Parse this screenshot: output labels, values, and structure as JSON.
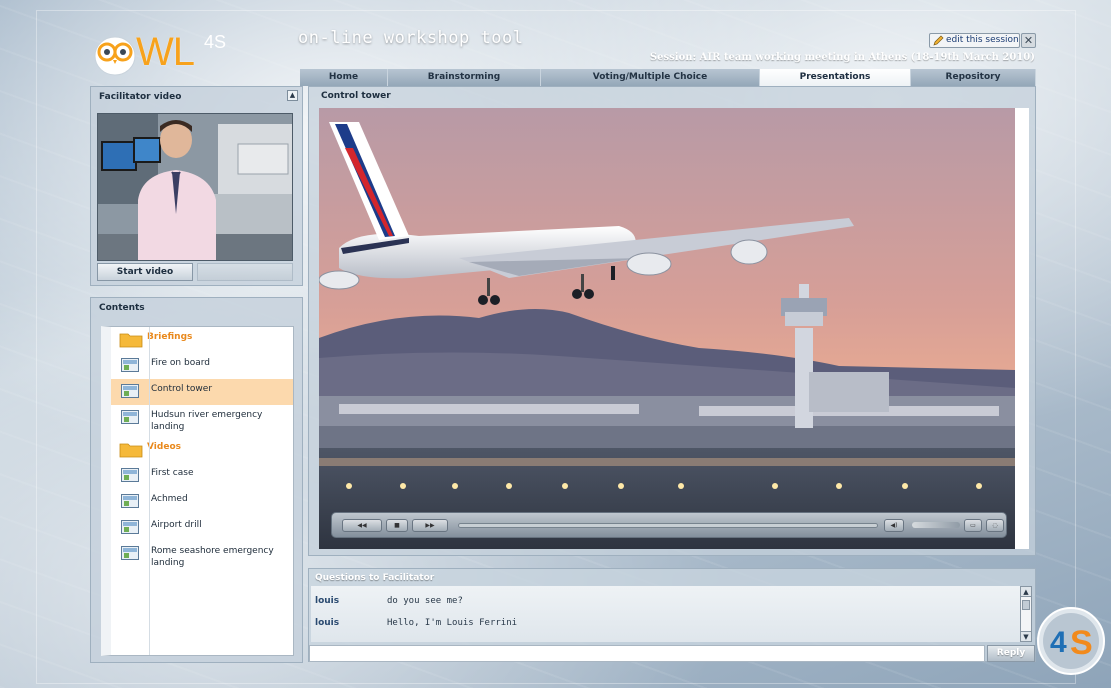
{
  "header": {
    "logo_text": "WL",
    "logo_sub": "4S",
    "app_title": "on-line workshop tool",
    "session_title": "Session: AIR team working meeting in Athens (18-19th March 2010)",
    "edit_label": "edit this session",
    "close_icon": "close-icon"
  },
  "tabs": [
    {
      "label": "Home",
      "active": false
    },
    {
      "label": "Brainstorming",
      "active": false
    },
    {
      "label": "Voting/Multiple Choice",
      "active": false
    },
    {
      "label": "Presentations",
      "active": true
    },
    {
      "label": "Repository",
      "active": false
    }
  ],
  "facilitator": {
    "title": "Facilitator video",
    "start_label": "Start video"
  },
  "contents": {
    "title": "Contents",
    "items": [
      {
        "type": "folder",
        "label": "Briefings"
      },
      {
        "type": "file",
        "label": "Fire on board"
      },
      {
        "type": "file",
        "label": "Control tower",
        "selected": true
      },
      {
        "type": "file",
        "label": "Hudsun river emergency landing"
      },
      {
        "type": "folder",
        "label": "Videos"
      },
      {
        "type": "file",
        "label": "First case"
      },
      {
        "type": "file",
        "label": "Achmed"
      },
      {
        "type": "file",
        "label": "Airport drill"
      },
      {
        "type": "file",
        "label": "Rome seashore emergency landing"
      }
    ]
  },
  "presentation": {
    "title": "Control tower"
  },
  "questions": {
    "title": "Questions to Facilitator",
    "messages": [
      {
        "user": "louis",
        "text": "do you see me?"
      },
      {
        "user": "louis",
        "text": "Hello, I'm Louis Ferrini"
      }
    ],
    "reply_label": "Reply"
  },
  "colors": {
    "accent_orange": "#f7a21c",
    "selected_row": "#fcd9ad",
    "tab_active": "#ffffff"
  }
}
